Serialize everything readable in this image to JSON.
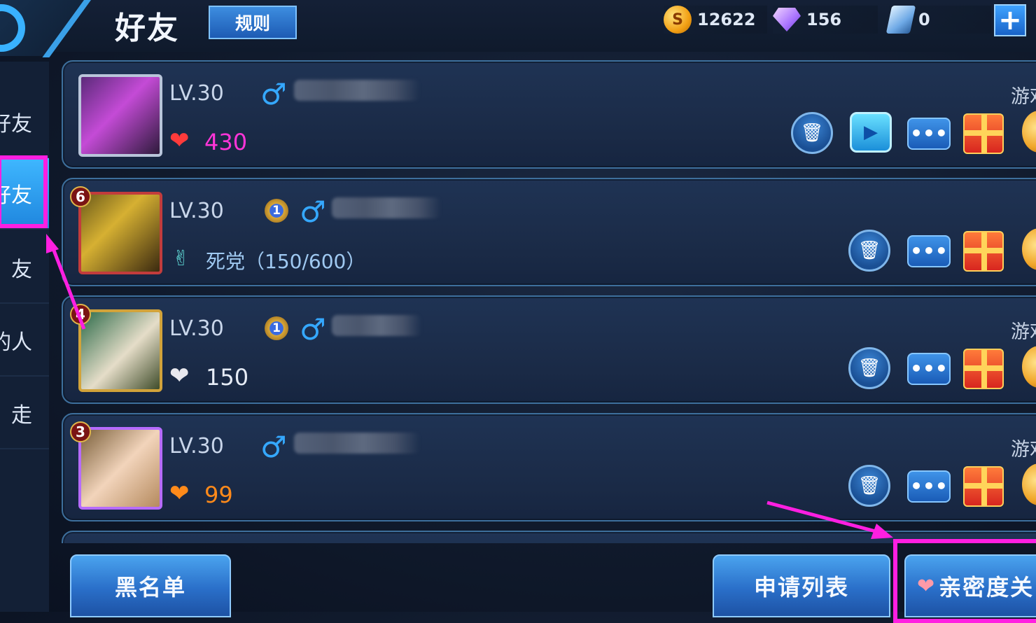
{
  "header": {
    "title": "好友",
    "rules_label": "规则",
    "gold": "12622",
    "diamonds": "156",
    "vouchers": "0",
    "add_label": "+"
  },
  "sidebar": {
    "items": [
      {
        "label": "好友"
      },
      {
        "label": "好友"
      },
      {
        "label": "友"
      },
      {
        "label": "的人"
      },
      {
        "label": "走"
      }
    ]
  },
  "friends": [
    {
      "level": "LV.30",
      "intimacy": "430",
      "status": "游戏",
      "heart_color": "#ff3b3b"
    },
    {
      "rank": "6",
      "level": "LV.30",
      "season_rank": "1",
      "relation": "死党（150/600）"
    },
    {
      "rank": "4",
      "level": "LV.30",
      "season_rank": "1",
      "intimacy": "150",
      "status": "游戏",
      "heart_color": "#e8e8ee"
    },
    {
      "rank": "3",
      "level": "LV.30",
      "intimacy": "99",
      "status": "游戏",
      "heart_color": "#ff8a1a"
    }
  ],
  "footer": {
    "blacklist_label": "黑名单",
    "requests_label": "申请列表",
    "intimacy_label": "亲密度关"
  },
  "icons": {
    "male": "♂",
    "chat": "•••",
    "trash": "🗑",
    "play": "▶",
    "relation": "✌"
  },
  "colors": {
    "highlight": "#ff1fe1",
    "accent": "#3fb7ff"
  }
}
